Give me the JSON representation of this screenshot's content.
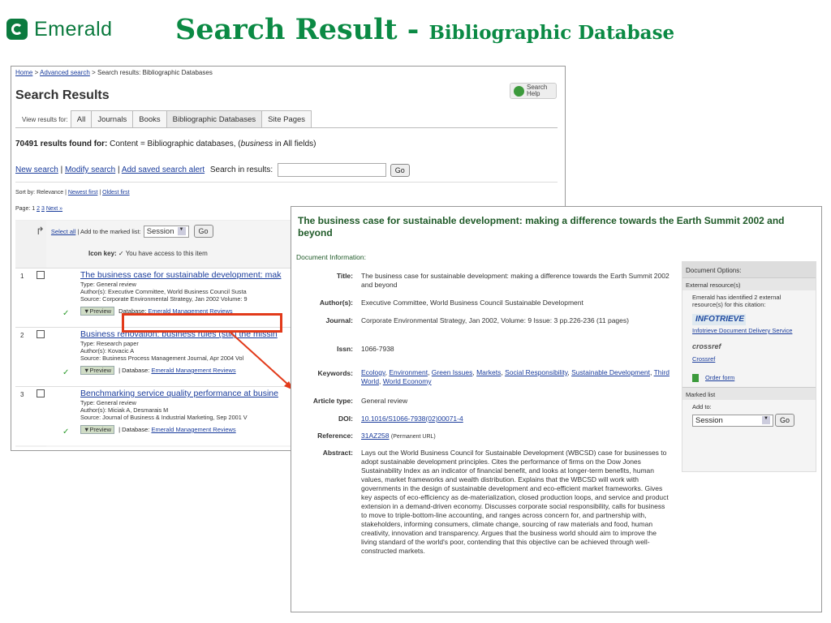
{
  "slide": {
    "brand": "Emerald",
    "title_main": "Search Result - ",
    "title_sub": "Bibliographic Database"
  },
  "left": {
    "breadcrumb": {
      "home": "Home",
      "sep1": " > ",
      "advanced": "Advanced search",
      "rest": " > Search results: Bibliographic Databases"
    },
    "page_title": "Search Results",
    "help_label_1": "Search",
    "help_label_2": "Help",
    "tabs_label": "View results for:",
    "tabs": [
      "All",
      "Journals",
      "Books",
      "Bibliographic Databases",
      "Site Pages"
    ],
    "results_count": "70491 results found for:",
    "results_query_a": " Content = Bibliographic databases, (",
    "results_query_em": "business",
    "results_query_b": " in All fields)",
    "new_search": "New search",
    "modify_search": "Modify search",
    "add_alert": "Add saved search alert",
    "search_in": "Search in results:",
    "go": "Go",
    "sort_label": "Sort by: Relevance |",
    "sort_newest": "Newest first",
    "sort_sep": "|",
    "sort_oldest": "Oldest first",
    "page_label": "Page: 1",
    "page_2": "2",
    "page_3": "3",
    "page_next": "Next »",
    "select_all": "Select all",
    "add_marked": "| Add to the marked list:",
    "session": "Session",
    "iconkey_bold": "Icon key:",
    "iconkey_rest": "✓ You have access to this item",
    "items": [
      {
        "num": "1",
        "title": "The business case for sustainable development: mak",
        "type": "Type: General review",
        "authors": "Author(s): Executive Committee, World Business Council Susta",
        "source": "Source: Corporate Environmental Strategy, Jan 2002 Volume: 9",
        "preview": "▼Preview",
        "db_label": "Database:",
        "db": "Emerald Management Reviews"
      },
      {
        "num": "2",
        "title": "Business renovation: business rules (still) the missin",
        "type": "Type: Research paper",
        "authors": "Author(s): Kovacic A",
        "source": "Source: Business Process Management Journal, Apr 2004 Vol",
        "preview": "▼Preview",
        "db_label": "| Database:",
        "db": "Emerald Management Reviews"
      },
      {
        "num": "3",
        "title": "Benchmarking service quality performance at busine",
        "type": "Type: General review",
        "authors": "Author(s): Miciak A, Desmarais M",
        "source": "Source: Journal of Business & Industrial Marketing, Sep 2001 V",
        "preview": "▼Preview",
        "db_label": "| Database:",
        "db": "Emerald Management Reviews"
      }
    ]
  },
  "right": {
    "title": "The business case for sustainable development: making a difference towards the Earth Summit 2002 and beyond",
    "doc_info": "Document Information:",
    "labels": {
      "title": "Title:",
      "authors": "Author(s):",
      "journal": "Journal:",
      "issn": "Issn:",
      "keywords": "Keywords:",
      "article_type": "Article type:",
      "doi": "DOI:",
      "reference": "Reference:",
      "abstract": "Abstract:"
    },
    "values": {
      "title": "The business case for sustainable development: making a difference towards the Earth Summit 2002 and beyond",
      "authors": "Executive Committee, World Business Council Sustainable Development",
      "journal": "Corporate Environmental Strategy, Jan 2002, Volume: 9 Issue: 3 pp.226-236 (11 pages)",
      "issn": "1066-7938",
      "keywords": [
        "Ecology",
        "Environment",
        "Green Issues",
        "Markets",
        "Social Responsibility",
        "Sustainable Development",
        "Third World",
        "World Economy"
      ],
      "article_type": "General review",
      "doi": "10.1016/S1066-7938(02)00071-4",
      "reference": "31AZ258",
      "reference_note": "(Permanent URL)",
      "abstract": "Lays out the World Business Council for Sustainable Development (WBCSD) case for businesses to adopt sustainable development principles. Cites the performance of firms on the Dow Jones Sustainability Index as an indicator of financial benefit, and looks at longer-term benefits, human values, market frameworks and wealth distribution. Explains that the WBCSD will work with governments in the design of sustainable development and eco-efficient market frameworks. Gives key aspects of eco-efficiency as de-materialization, closed production loops, and service and product extension in a demand-driven economy. Discusses corporate social responsibility, calls for business to move to triple-bottom-line accounting, and ranges across concern for, and partnership with, stakeholders, informing consumers, climate change, sourcing of raw materials and food, human creativity, innovation and transparency. Argues that the business world should aim to improve the living standard of the world's poor, contending that this objective can be achieved through well-constructed markets."
    },
    "options": {
      "header": "Document Options:",
      "external": "External resource(s)",
      "identified": "Emerald has identified 2 external resource(s) for this citation:",
      "infotrieve_logo": "INFOTRIEVE",
      "infotrieve_link": "Infotrieve Document Delivery Service",
      "crossref_logo": "crossref",
      "crossref_link": "Crossref",
      "order_form": "Order form",
      "marked_list": "Marked list",
      "add_to": "Add to:",
      "session": "Session",
      "go": "Go"
    }
  },
  "colors": {
    "brand_green": "#0b8a44",
    "link": "#1a3c9c",
    "highlight": "#e23a1a"
  }
}
